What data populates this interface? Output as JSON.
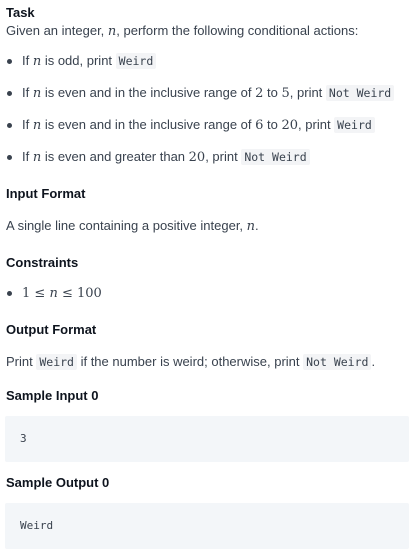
{
  "task": {
    "heading": "Task",
    "intro_pre": "Given an integer, ",
    "intro_var": "n",
    "intro_post": ", perform the following conditional actions:",
    "rules": [
      {
        "pre": "If ",
        "var": "n",
        "mid": " is odd, print ",
        "code": "Weird"
      },
      {
        "pre": "If ",
        "var": "n",
        "mid": " is even and in the inclusive range of ",
        "lo": "2",
        "to": " to ",
        "hi": "5",
        "post": ", print ",
        "code": "Not Weird"
      },
      {
        "pre": "If ",
        "var": "n",
        "mid": " is even and in the inclusive range of ",
        "lo": "6",
        "to": " to ",
        "hi": "20",
        "post": ", print ",
        "code": "Weird"
      },
      {
        "pre": "If ",
        "var": "n",
        "mid": " is even and greater than ",
        "hi": "20",
        "post": ", print ",
        "code": "Not Weird"
      }
    ]
  },
  "input_format": {
    "heading": "Input Format",
    "text_pre": "A single line containing a positive integer, ",
    "var": "n",
    "text_post": "."
  },
  "constraints": {
    "heading": "Constraints",
    "items": [
      {
        "lo": "1",
        "le1": " ≤ ",
        "var": "n",
        "le2": " ≤ ",
        "hi": "100"
      }
    ]
  },
  "output_format": {
    "heading": "Output Format",
    "pre": "Print ",
    "code1": "Weird",
    "mid": " if the number is weird; otherwise, print ",
    "code2": "Not Weird",
    "post": "."
  },
  "sample_input": {
    "heading": "Sample Input 0",
    "value": "3"
  },
  "sample_output": {
    "heading": "Sample Output 0",
    "value": "Weird"
  },
  "colors": {
    "text": "#39424e",
    "heading": "#0e141e",
    "code_bg": "#f3f6f9"
  }
}
